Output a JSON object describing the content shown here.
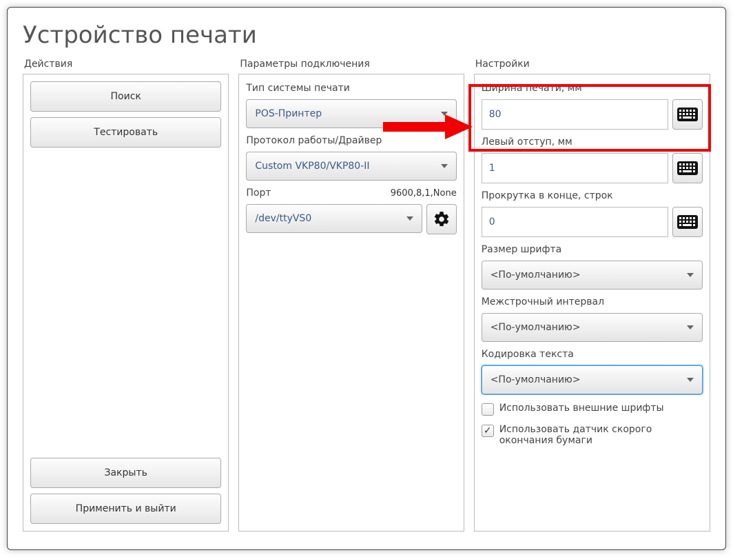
{
  "page_title": "Устройство печати",
  "columns": {
    "actions": {
      "title": "Действия"
    },
    "params": {
      "title": "Параметры подключения"
    },
    "settings": {
      "title": "Настройки"
    }
  },
  "actions": {
    "search": "Поиск",
    "test": "Тестировать",
    "close": "Закрыть",
    "apply_exit": "Применить и выйти"
  },
  "params": {
    "print_system_label": "Тип системы печати",
    "print_system_value": "POS-Принтер",
    "driver_label": "Протокол работы/Драйвер",
    "driver_value": "Custom VKP80/VKP80-II",
    "port_label": "Порт",
    "port_info": "9600,8,1,None",
    "port_value": "/dev/ttyVS0"
  },
  "settings": {
    "print_width_label": "Ширина печати, мм",
    "print_width_value": "80",
    "left_margin_label": "Левый отступ, мм",
    "left_margin_value": "1",
    "scroll_end_label": "Прокрутка в конце, строк",
    "scroll_end_value": "0",
    "font_size_label": "Размер шрифта",
    "font_size_value": "<По-умолчанию>",
    "line_spacing_label": "Межстрочный интервал",
    "line_spacing_value": "<По-умолчанию>",
    "encoding_label": "Кодировка текста",
    "encoding_value": "<По-умолчанию>",
    "use_external_fonts": "Использовать внешние шрифты",
    "use_paper_sensor": "Использовать датчик скорого окончания бумаги"
  }
}
